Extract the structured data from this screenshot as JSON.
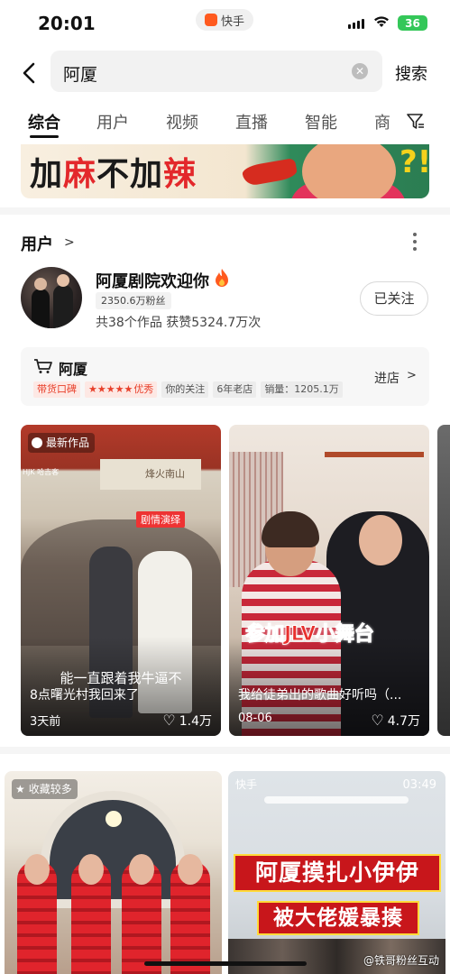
{
  "status_bar": {
    "time": "20:01",
    "app_name": "快手",
    "battery": "36"
  },
  "search": {
    "query": "阿厦",
    "clear_icon": "clear-circle-icon",
    "submit_label": "搜索"
  },
  "tabs": [
    {
      "label": "综合",
      "active": true
    },
    {
      "label": "用户",
      "active": false
    },
    {
      "label": "视频",
      "active": false
    },
    {
      "label": "直播",
      "active": false
    },
    {
      "label": "智能",
      "active": false
    },
    {
      "label": "商",
      "active": false
    }
  ],
  "banner": {
    "text_a": "加",
    "text_b": "麻",
    "text_c": "不加",
    "text_d": "辣",
    "qmarks": "?!"
  },
  "users_section": {
    "title": "用户",
    "user": {
      "name": "阿厦剧院欢迎你",
      "fans": "2350.6万粉丝",
      "stats": "共38个作品 获赞5324.7万次",
      "follow_label": "已关注"
    },
    "shop": {
      "name": "阿厦",
      "enter_label": "进店",
      "tags": {
        "koubei": "带货口碑",
        "stars": "★★★★★",
        "rating_word": "优秀",
        "your_follow": "你的关注",
        "old_store": "6年老店",
        "sales": "销量：1205.1万"
      }
    }
  },
  "videos_row1": [
    {
      "tag": "最新作品",
      "subtitle": "能一直跟着我牛逼不",
      "title": "8点曙光村我回来了",
      "date": "3天前",
      "likes": "1.4万",
      "overlay_badge": "剧情演绎",
      "sign_text": "烽火南山",
      "corner_text": "HJK 哈吉客"
    },
    {
      "overlay_title": "参加JLV小舞台",
      "title": "我给徒弟出的歌曲好听吗（...",
      "date": "08-06",
      "likes": "4.7万"
    }
  ],
  "videos_row2": [
    {
      "tag": "收藏较多"
    },
    {
      "logo": "快手",
      "duration": "03:49",
      "line1": "阿厦摸扎小伊伊",
      "line2": "被大佬媛暴揍"
    }
  ],
  "watermark": "@铁哥粉丝互动",
  "colors": {
    "accent_red": "#e8402b",
    "follow_border": "#d8d8d8",
    "battery_green": "#34c759",
    "kuaishou_orange": "#ff5a1f"
  }
}
